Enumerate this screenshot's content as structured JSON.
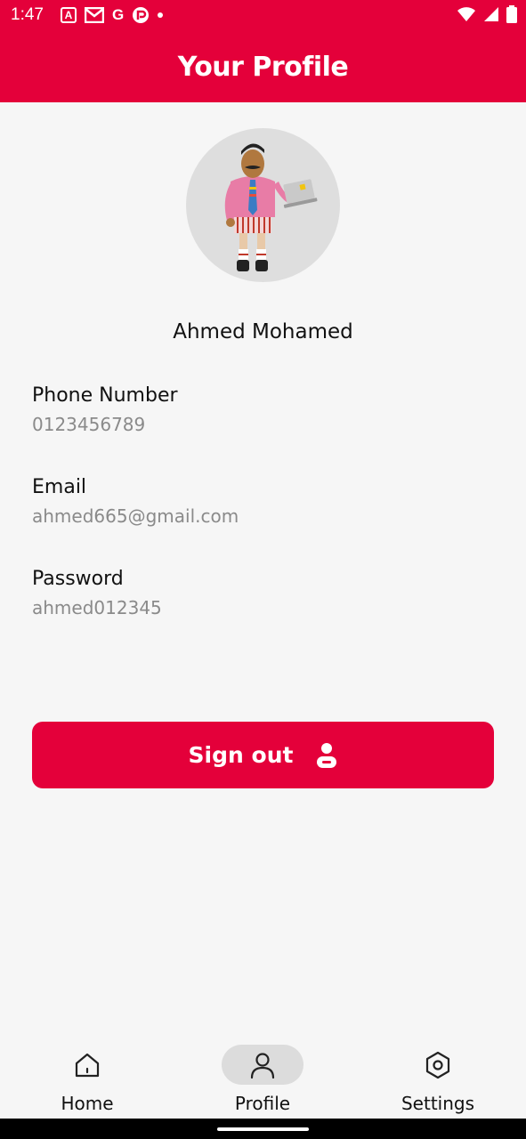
{
  "status_bar": {
    "time": "1:47",
    "left_icons": [
      "a-box-icon",
      "gmail-icon",
      "google-icon",
      "app-icon",
      "dot-icon"
    ],
    "right_icons": [
      "wifi-icon",
      "signal-icon",
      "battery-icon"
    ],
    "a_box_text": "A",
    "google_text": "G"
  },
  "app_bar": {
    "title": "Your Profile"
  },
  "profile": {
    "name": "Ahmed Mohamed",
    "fields": [
      {
        "label": "Phone Number",
        "value": "0123456789"
      },
      {
        "label": "Email",
        "value": "ahmed665@gmail.com"
      },
      {
        "label": "Password",
        "value": "ahmed012345"
      }
    ]
  },
  "signout": {
    "label": "Sign out",
    "icon": "person-icon"
  },
  "bottom_nav": {
    "items": [
      {
        "label": "Home",
        "icon": "home-icon",
        "active": false
      },
      {
        "label": "Profile",
        "icon": "profile-icon",
        "active": true
      },
      {
        "label": "Settings",
        "icon": "settings-icon",
        "active": false
      }
    ]
  },
  "colors": {
    "accent": "#e4003a",
    "background": "#f6f6f6",
    "muted_text": "#8a8a8a"
  }
}
